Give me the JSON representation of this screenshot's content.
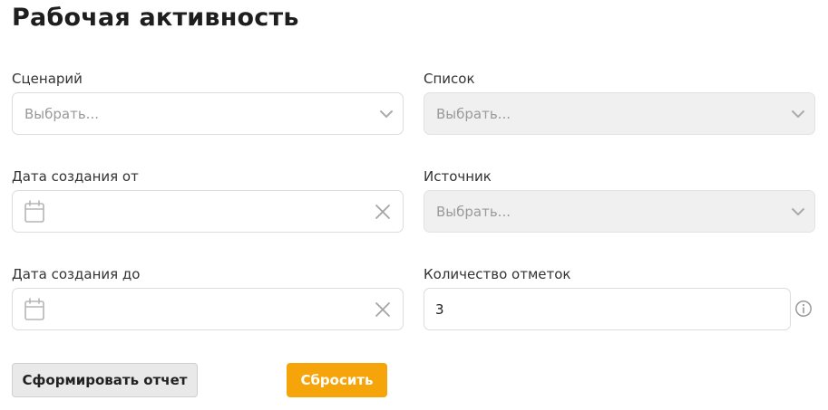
{
  "page": {
    "title": "Рабочая активность"
  },
  "form": {
    "scenario": {
      "label": "Сценарий",
      "placeholder": "Выбрать...",
      "disabled": false
    },
    "list": {
      "label": "Список",
      "placeholder": "Выбрать...",
      "disabled": true
    },
    "date_from": {
      "label": "Дата создания от",
      "value": ""
    },
    "source": {
      "label": "Источник",
      "placeholder": "Выбрать...",
      "disabled": true
    },
    "date_to": {
      "label": "Дата создания до",
      "value": ""
    },
    "marks_count": {
      "label": "Количество отметок",
      "value": "3"
    }
  },
  "actions": {
    "report_label": "Сформировать отчет",
    "reset_label": "Сбросить"
  },
  "colors": {
    "accent": "#f5a40a",
    "disabled_bg": "#f0f0f0",
    "border": "#dcdcdc"
  },
  "icons": {
    "select": "chevron-down-icon",
    "date": "calendar-icon",
    "clear": "close-icon",
    "help": "info-icon"
  }
}
